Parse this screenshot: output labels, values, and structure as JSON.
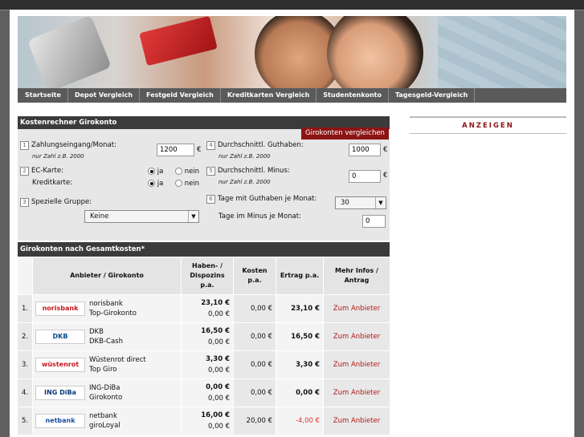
{
  "nav": [
    "Startseite",
    "Depot Vergleich",
    "Festgeld Vergleich",
    "Kreditkarten Vergleich",
    "Studentenkonto",
    "Tagesgeld-Vergleich"
  ],
  "calculator": {
    "title": "Kostenrechner Girokonto",
    "f1": {
      "num": "1",
      "label": "Zahlungseingang/Monat:",
      "hint": "nur Zahl z.B. 2000",
      "value": "1200",
      "unit": "€"
    },
    "f2": {
      "num": "2",
      "label1": "EC-Karte:",
      "label2": "Kreditkarte:",
      "yes": "ja",
      "no": "nein"
    },
    "f3": {
      "num": "3",
      "label": "Spezielle Gruppe:",
      "selected": "Keine"
    },
    "f4": {
      "num": "4",
      "label": "Durchschnittl. Guthaben:",
      "hint": "nur Zahl z.B. 2000",
      "value": "1000",
      "unit": "€"
    },
    "f5": {
      "num": "5",
      "label": "Durchschnittl. Minus:",
      "hint": "nur Zahl z.B. 2000",
      "value": "0",
      "unit": "€"
    },
    "f6": {
      "num": "6",
      "label1": "Tage mit Guthaben je Monat:",
      "selected": "30",
      "label2": "Tage im Minus je Monat:",
      "value2": "0"
    },
    "compare_button": "Girokonten vergleichen"
  },
  "results": {
    "title": "Girokonten nach Gesamtkosten*",
    "headers": {
      "provider": "Anbieter / Girokonto",
      "interest1": "Haben- /",
      "interest2": "Dispozins",
      "interest3": "p.a.",
      "cost1": "Kosten",
      "cost2": "p.a.",
      "yield": "Ertrag p.a.",
      "more1": "Mehr Infos /",
      "more2": "Antrag"
    },
    "rows": [
      {
        "rank": "1.",
        "logo": "norisbank",
        "logo_color": "#c8161d",
        "bank": "norisbank",
        "product": "Top-Girokonto",
        "haben": "23,10 €",
        "dispo": "0,00 €",
        "cost": "0,00 €",
        "yield": "23,10 €",
        "link": "Zum Anbieter"
      },
      {
        "rank": "2.",
        "logo": "DKB",
        "logo_color": "#0a4a93",
        "bank": "DKB",
        "product": "DKB-Cash",
        "haben": "16,50 €",
        "dispo": "0,00 €",
        "cost": "0,00 €",
        "yield": "16,50 €",
        "link": "Zum Anbieter"
      },
      {
        "rank": "3.",
        "logo": "wüstenrot",
        "logo_color": "#c8161d",
        "bank": "Wüstenrot direct",
        "product": "Top Giro",
        "haben": "3,30 €",
        "dispo": "0,00 €",
        "cost": "0,00 €",
        "yield": "3,30 €",
        "link": "Zum Anbieter"
      },
      {
        "rank": "4.",
        "logo": "ING DiBa",
        "logo_color": "#0a3a7a",
        "bank": "ING-DiBa",
        "product": "Girokonto",
        "haben": "0,00 €",
        "dispo": "0,00 €",
        "cost": "0,00 €",
        "yield": "0,00 €",
        "link": "Zum Anbieter"
      },
      {
        "rank": "5.",
        "logo": "netbank",
        "logo_color": "#1a4f9c",
        "bank": "netbank",
        "product": "giroLoyal",
        "haben": "16,00 €",
        "dispo": "0,00 €",
        "cost": "20,00 €",
        "yield": "-4,00 €",
        "link": "Zum Anbieter"
      }
    ]
  },
  "sidebar": {
    "ads_label": "ANZEIGEN"
  }
}
